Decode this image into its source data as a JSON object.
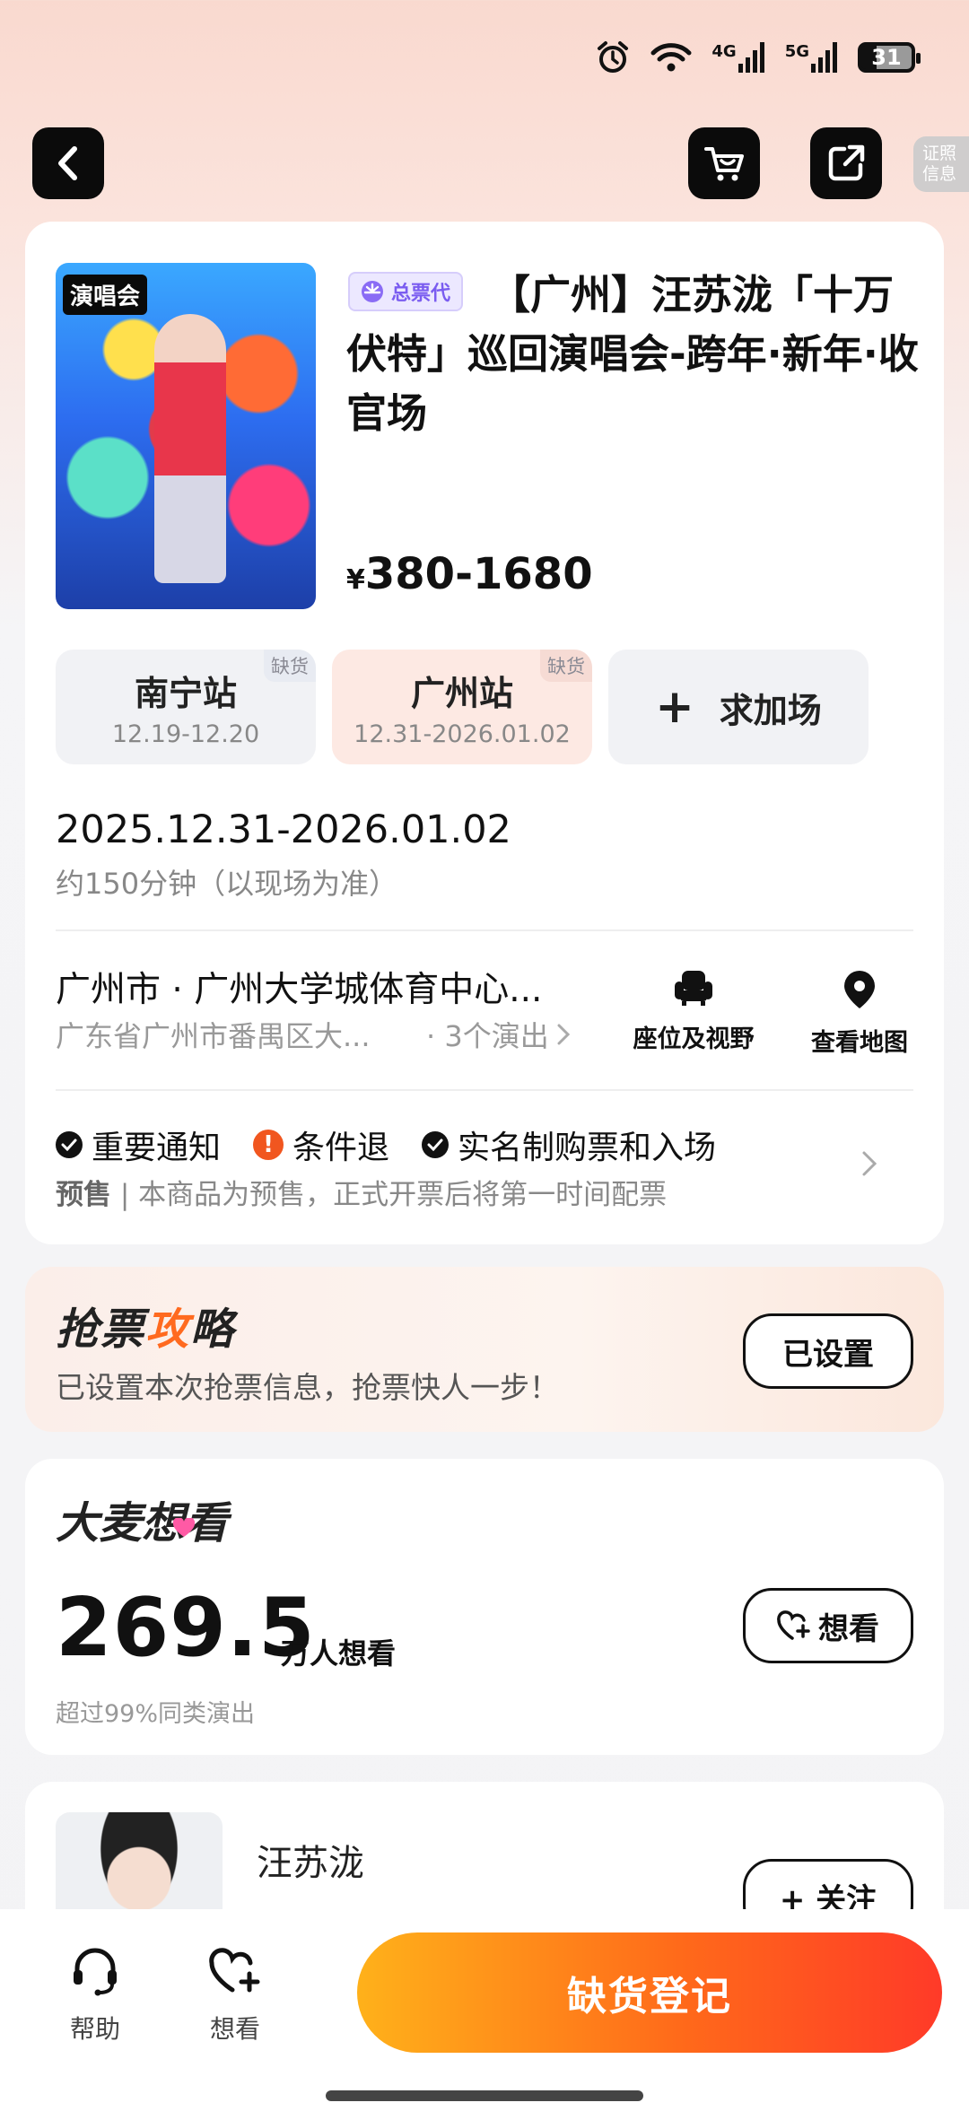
{
  "status_bar": {
    "battery": "31",
    "network_1": "4G",
    "network_2": "5G"
  },
  "nav": {
    "cert_label_1": "证照",
    "cert_label_2": "信息"
  },
  "event": {
    "poster_tag": "演唱会",
    "agent_badge": "总票代",
    "title": "【广州】汪苏泷「十万伏特」巡回演唱会-跨年·新年·收官场",
    "price_symbol": "¥",
    "price_range": "380-1680"
  },
  "stations": [
    {
      "name": "南宁站",
      "dates": "12.19-12.20",
      "status": "缺货"
    },
    {
      "name": "广州站",
      "dates": "12.31-2026.01.02",
      "status": "缺货"
    }
  ],
  "add_show_label": "求加场",
  "schedule": {
    "date": "2025.12.31-2026.01.02",
    "duration": "约150分钟（以现场为准）"
  },
  "venue": {
    "name": "广州市 · 广州大学城体育中心...",
    "address": "广东省广州市番禺区大...",
    "shows": "· 3个演出",
    "seat_label": "座位及视野",
    "map_label": "查看地图"
  },
  "notices": {
    "items": [
      "重要通知",
      "条件退",
      "实名制购票和入场"
    ],
    "presale_tag": "预售",
    "presale_text": "| 本商品为预售，正式开票后将第一时间配票"
  },
  "strategy": {
    "title_a": "抢票",
    "title_b": "攻",
    "title_c": "略",
    "subtitle": "已设置本次抢票信息，抢票快人一步！",
    "button": "已设置"
  },
  "want": {
    "title_a": "大麦想",
    "title_b": "看",
    "count": "269.5",
    "unit": "万人想看",
    "compare": "超过99%同类演出",
    "button": "想看"
  },
  "artist": {
    "name": "汪苏泷",
    "follow_button": "+ 关注"
  },
  "bottom": {
    "help_label": "帮助",
    "want_label": "想看",
    "register_button": "缺货登记"
  },
  "colors": {
    "accent": "#ff6a1f",
    "badge_purple": "#7a5cf0",
    "button_start": "#ffb11a",
    "button_end": "#ff3a28"
  }
}
